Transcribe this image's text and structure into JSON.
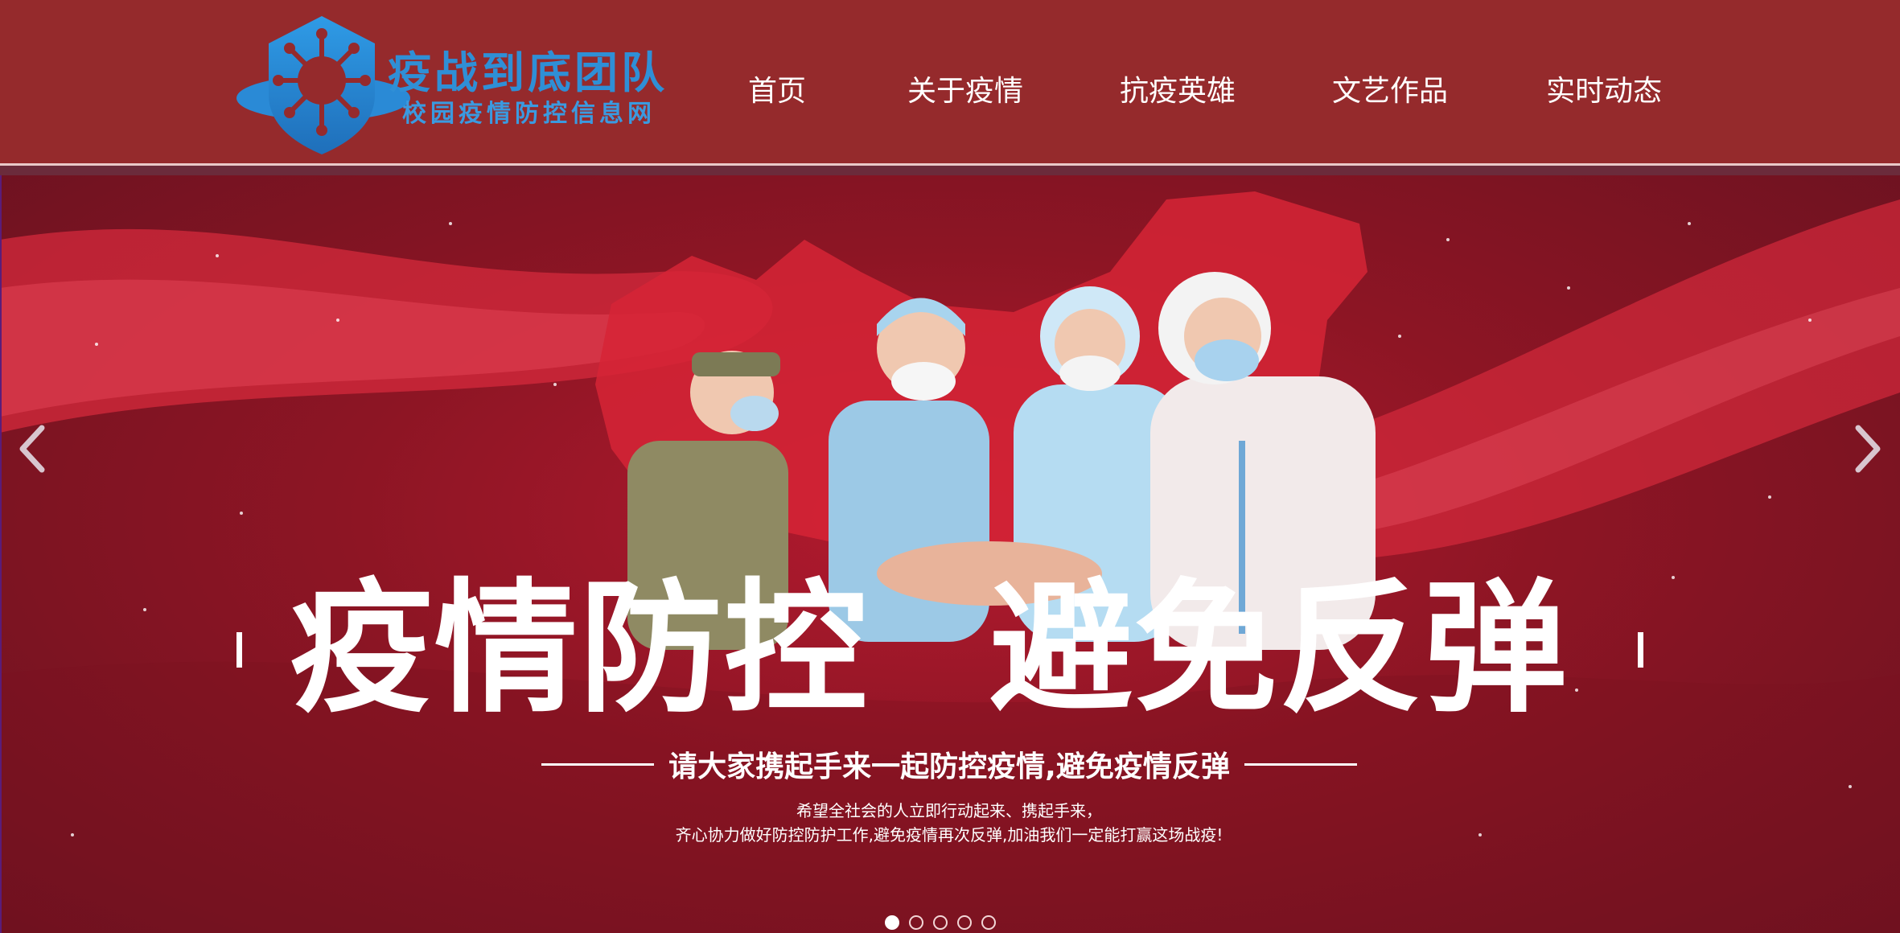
{
  "header": {
    "logo_title": "疫战到底团队",
    "logo_subtitle": "校园疫情防控信息网"
  },
  "nav": {
    "items": [
      "首页",
      "关于疫情",
      "抗疫英雄",
      "文艺作品",
      "实时动态"
    ]
  },
  "banner": {
    "headline_left": "疫情防控",
    "headline_right": "避免反弹",
    "slogan": "请大家携起手来一起防控疫情,避免疫情反弹",
    "description_line1": "希望全社会的人立即行动起来、携起手来，",
    "description_line2": "齐心协力做好防控防护工作,避免疫情再次反弹,加油我们一定能打赢这场战疫!",
    "slide_count": 5,
    "active_slide": 1
  },
  "colors": {
    "header_bg": "#952a2c",
    "banner_red": "#b31a2f",
    "logo_blue": "#2f8fd6"
  },
  "icons": {
    "logo": "virus-shield-icon",
    "prev": "chevron-left-icon",
    "next": "chevron-right-icon"
  }
}
